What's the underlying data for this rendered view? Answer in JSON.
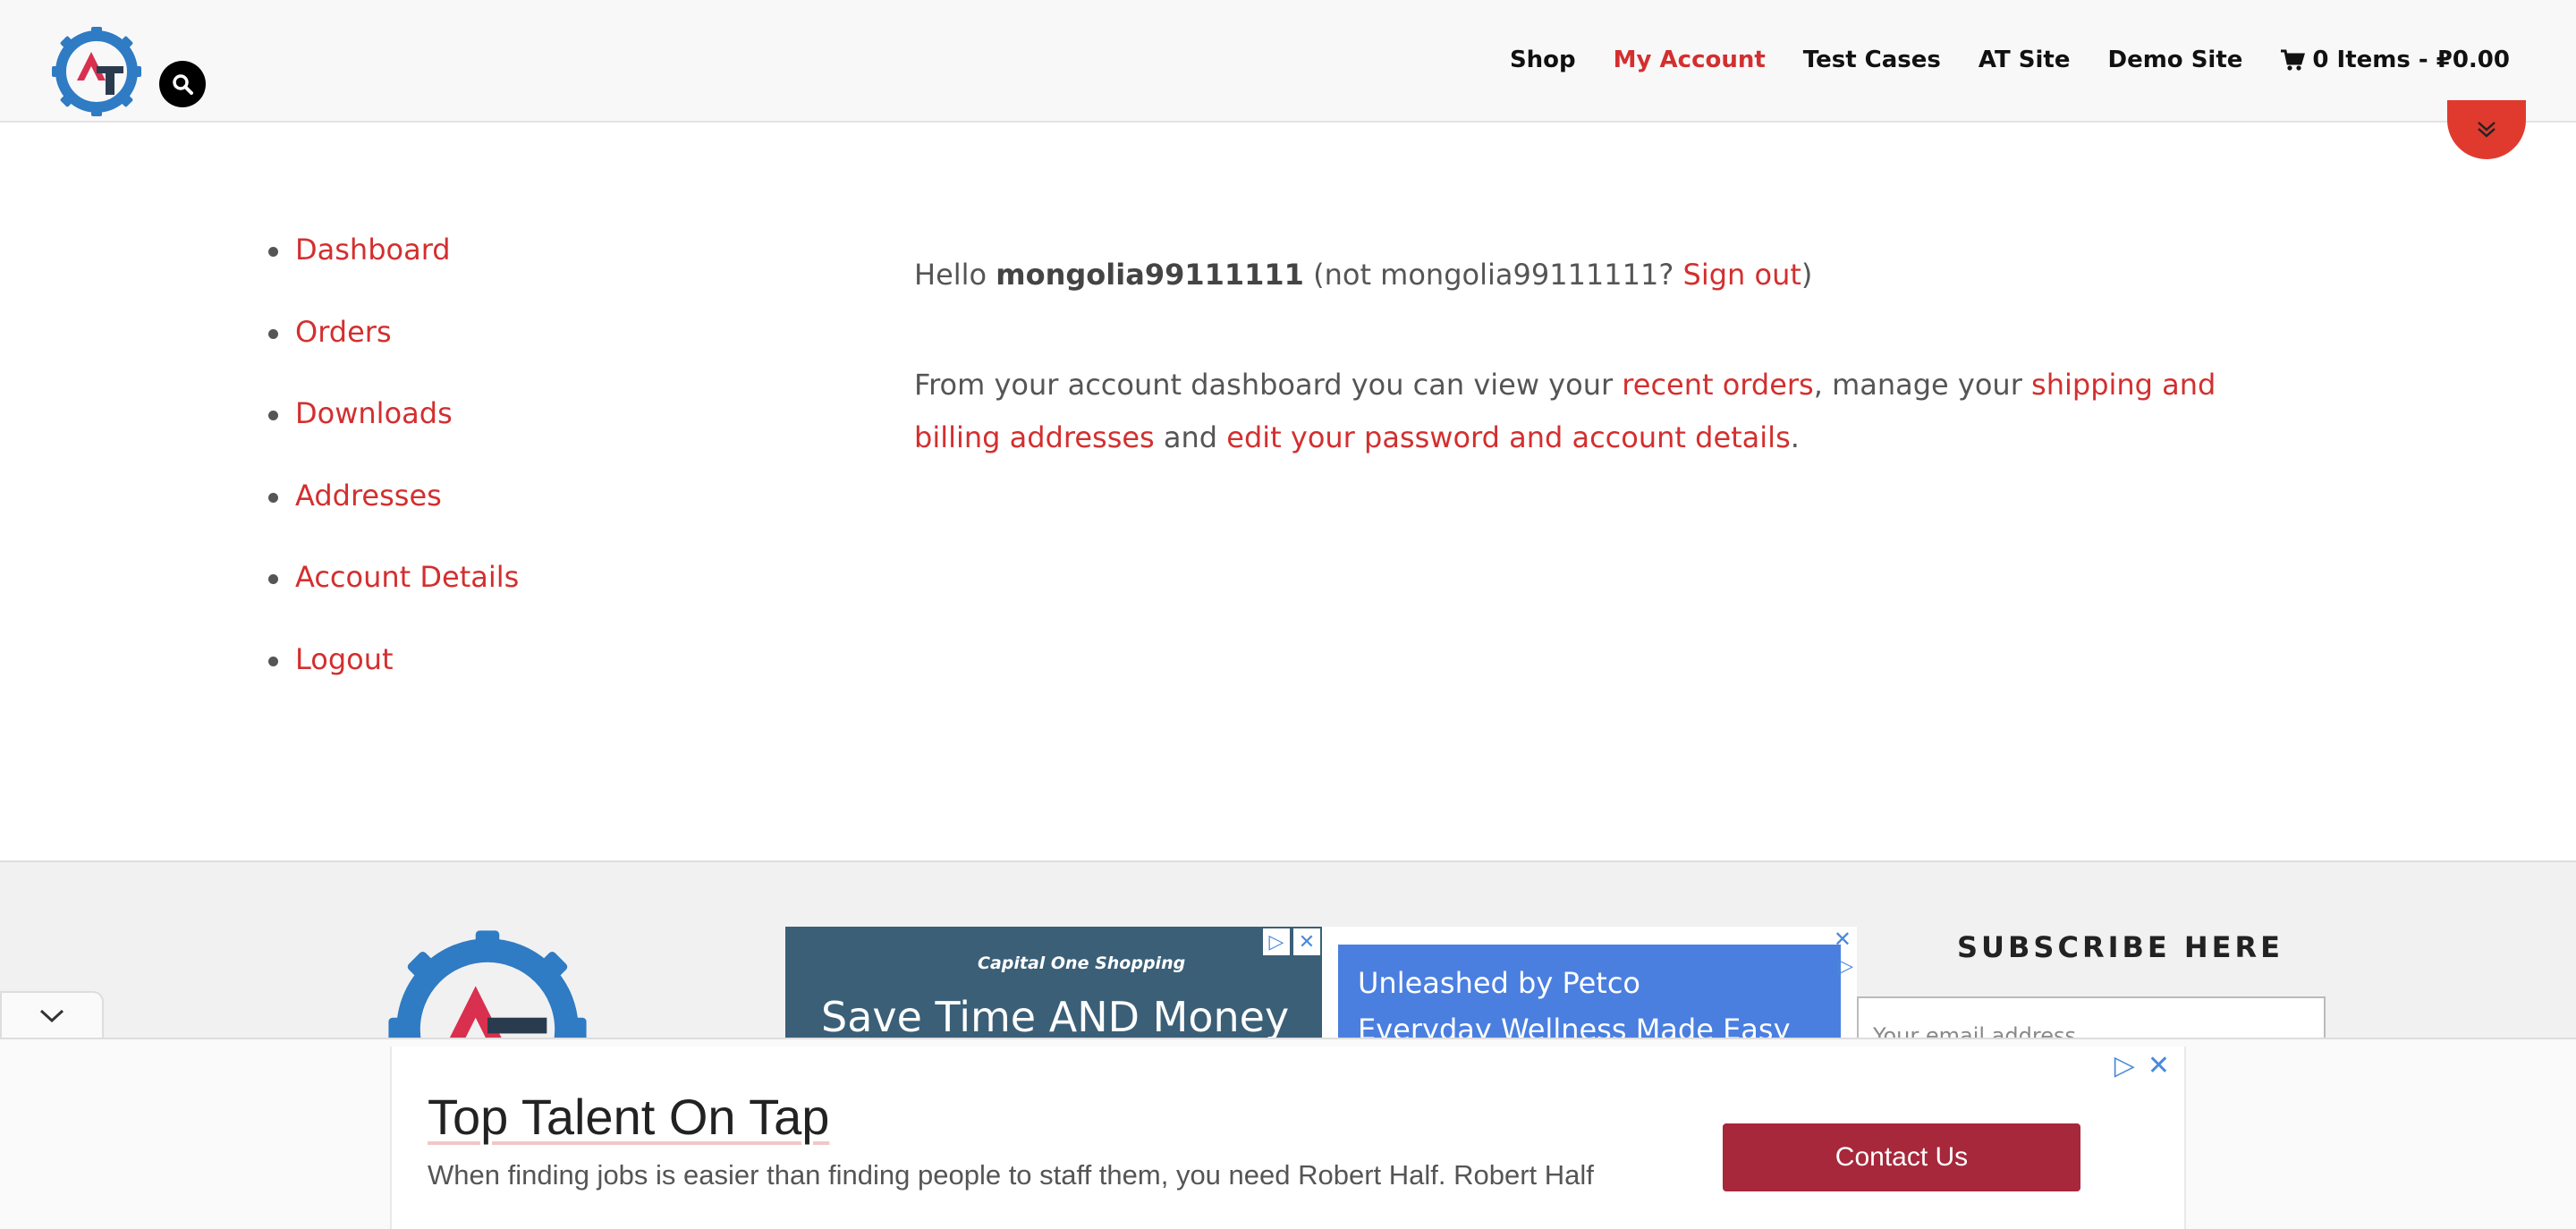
{
  "header": {
    "nav": [
      {
        "label": "Shop"
      },
      {
        "label": "My Account"
      },
      {
        "label": "Test Cases"
      },
      {
        "label": "AT Site"
      },
      {
        "label": "Demo Site"
      }
    ],
    "cart_label": "0 Items - ₽0.00",
    "active_color": "#d32f2f"
  },
  "account_nav": [
    {
      "label": "Dashboard"
    },
    {
      "label": "Orders"
    },
    {
      "label": "Downloads"
    },
    {
      "label": "Addresses"
    },
    {
      "label": "Account Details"
    },
    {
      "label": "Logout"
    }
  ],
  "dashboard": {
    "hello": "Hello",
    "username": "mongolia99111111",
    "not_prefix": "(not mongolia99111111?",
    "sign_out": "Sign out",
    "close_paren": ")",
    "intro": "From your account dashboard you can view your",
    "recent_orders": "recent orders",
    "manage": ", manage your",
    "addresses_link": "shipping and billing addresses",
    "and": "and",
    "edit_link": "edit your password and account details",
    "period": "."
  },
  "footer": {
    "ad1_brand": "Capital One Shopping",
    "ad1_headline": "Save Time AND Money",
    "ad2_line1": "Unleashed by Petco",
    "ad2_line2": "Everyday Wellness Made Easy",
    "subscribe_title": "SUBSCRIBE HERE",
    "email_placeholder": "Your email address"
  },
  "sticky_ad": {
    "title": "Top Talent On Tap",
    "description": "When finding jobs is easier than finding people to staff them, you need Robert Half. Robert Half",
    "cta": "Contact Us"
  }
}
